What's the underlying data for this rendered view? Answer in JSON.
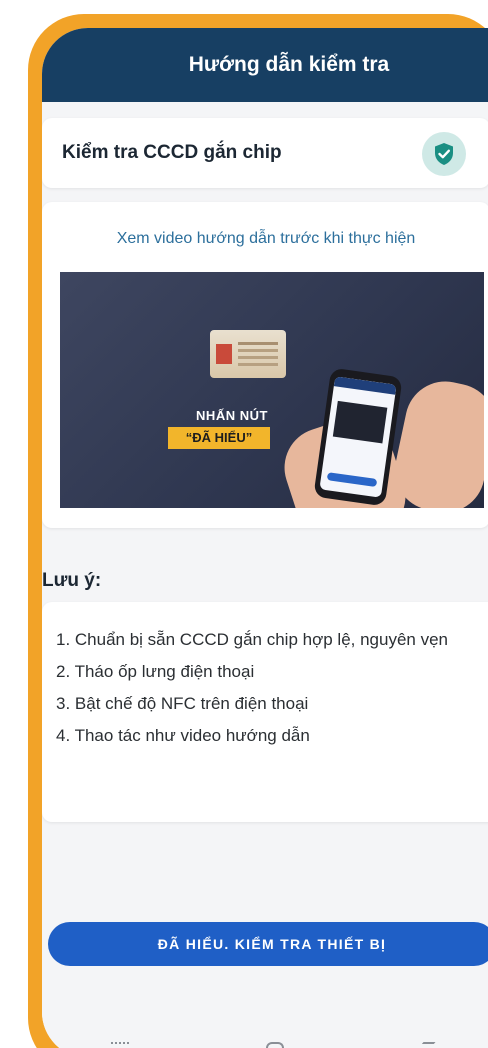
{
  "header": {
    "title": "Hướng dẫn kiểm tra"
  },
  "chip_card": {
    "title": "Kiểm tra CCCD gắn chip",
    "icon": "shield-check-icon"
  },
  "video_card": {
    "hint": "Xem video hướng dẫn trước khi thực hiện",
    "overlay_line1": "NHẤN NÚT",
    "overlay_line2": "“ĐÃ HIỂU”"
  },
  "notes": {
    "title": "Lưu ý:",
    "items": [
      "1. Chuẩn bị sẵn CCCD gắn chip hợp lệ, nguyên vẹn",
      "2. Tháo ốp lưng điện thoại",
      "3. Bật chế độ NFC trên điện thoại",
      "4. Thao tác như video hướng dẫn"
    ]
  },
  "cta": {
    "label": "ĐÃ HIỂU. KIỂM TRA THIẾT BỊ"
  },
  "colors": {
    "frame": "#f2a328",
    "header": "#173f63",
    "accent": "#1f5fc6",
    "shield": "#1a8f83",
    "hint_text": "#2c6f9c"
  }
}
